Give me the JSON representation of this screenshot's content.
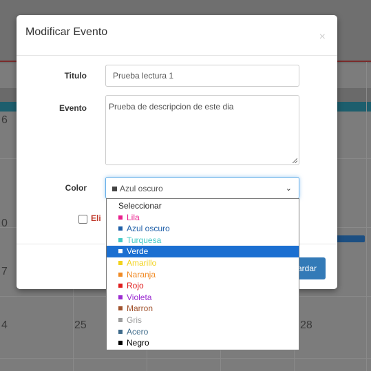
{
  "background": {
    "day_numbers": [
      "6",
      "0",
      "7",
      "4",
      "25",
      "28"
    ]
  },
  "modal": {
    "title": "Modificar Evento",
    "close_glyph": "×",
    "fields": {
      "title_label": "Titulo",
      "title_value": "Prueba lectura 1",
      "event_label": "Evento",
      "event_value": "Prueba de descripcion de este dia",
      "color_label": "Color",
      "color_selected": "Azul oscuro",
      "delete_label": "Eli",
      "save_label": "ardar"
    }
  },
  "dropdown": {
    "selected_index": 4,
    "options": [
      {
        "label": "Seleccionar",
        "color": null
      },
      {
        "label": "Lila",
        "color": "#e91e8c"
      },
      {
        "label": "Azul oscuro",
        "color": "#1f5fa8"
      },
      {
        "label": "Turquesa",
        "color": "#40c9c6"
      },
      {
        "label": "Verde",
        "color": "#2e9e44"
      },
      {
        "label": "Amarillo",
        "color": "#f2d21b"
      },
      {
        "label": "Naranja",
        "color": "#f08a24"
      },
      {
        "label": "Rojo",
        "color": "#e01e1e"
      },
      {
        "label": "Violeta",
        "color": "#9b2bd1"
      },
      {
        "label": "Marron",
        "color": "#a0522d"
      },
      {
        "label": "Gris",
        "color": "#9e9e9e"
      },
      {
        "label": "Acero",
        "color": "#3d6a8a"
      },
      {
        "label": "Negro",
        "color": "#000000"
      }
    ]
  }
}
